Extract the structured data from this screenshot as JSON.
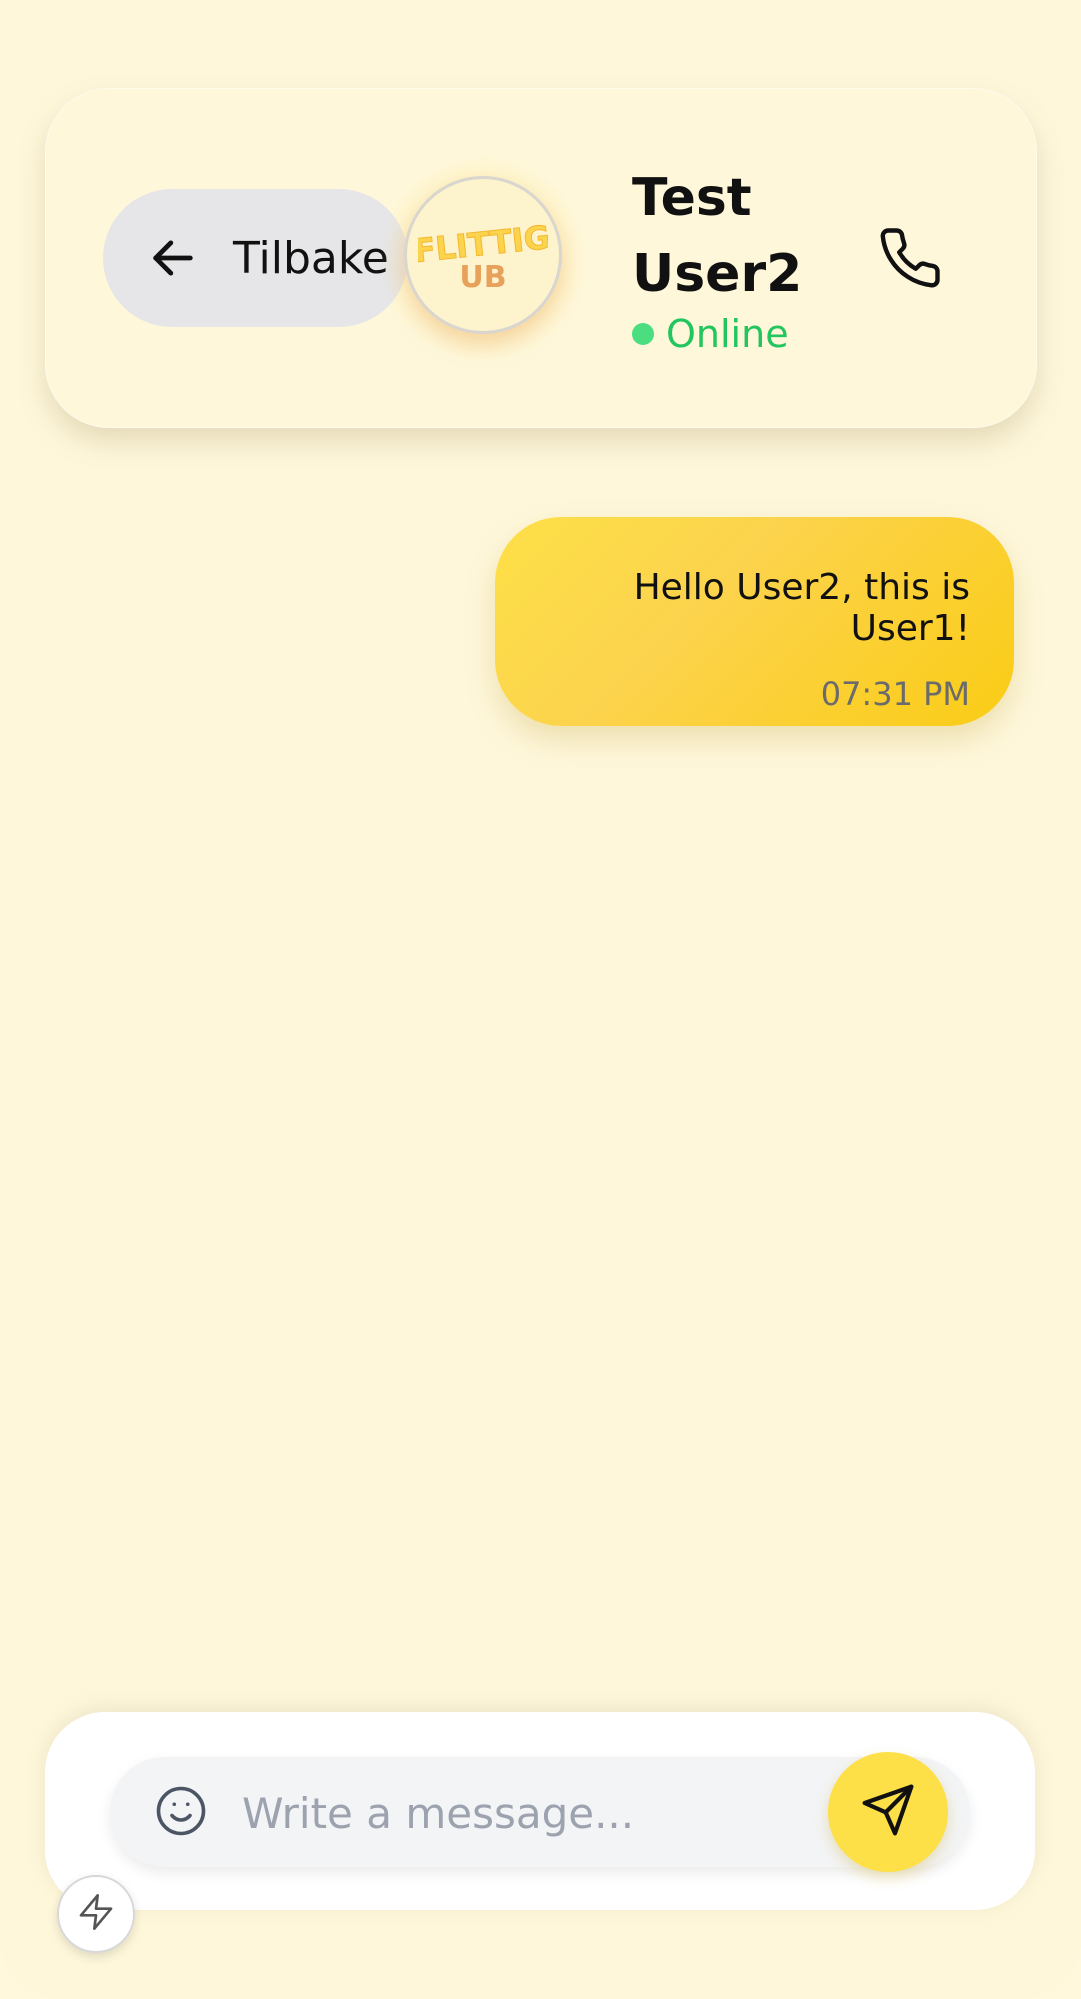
{
  "header": {
    "back_label": "Tilbake",
    "logo_text_top": "FLITTIG",
    "logo_text_bottom": "UB",
    "contact_name": "Test User2",
    "status_text": "Online",
    "status_color": "#22c55e"
  },
  "messages": [
    {
      "text": "Hello User2, this is User1!",
      "time": "07:31 PM",
      "direction": "outgoing"
    }
  ],
  "composer": {
    "placeholder": "Write a message...",
    "value": ""
  },
  "colors": {
    "background": "#fef7da",
    "accent": "#fde047",
    "bubble": "#facc15"
  },
  "icons": {
    "back": "arrow-left-icon",
    "call": "phone-icon",
    "emoji": "smile-icon",
    "send": "send-icon",
    "quick": "lightning-icon"
  }
}
